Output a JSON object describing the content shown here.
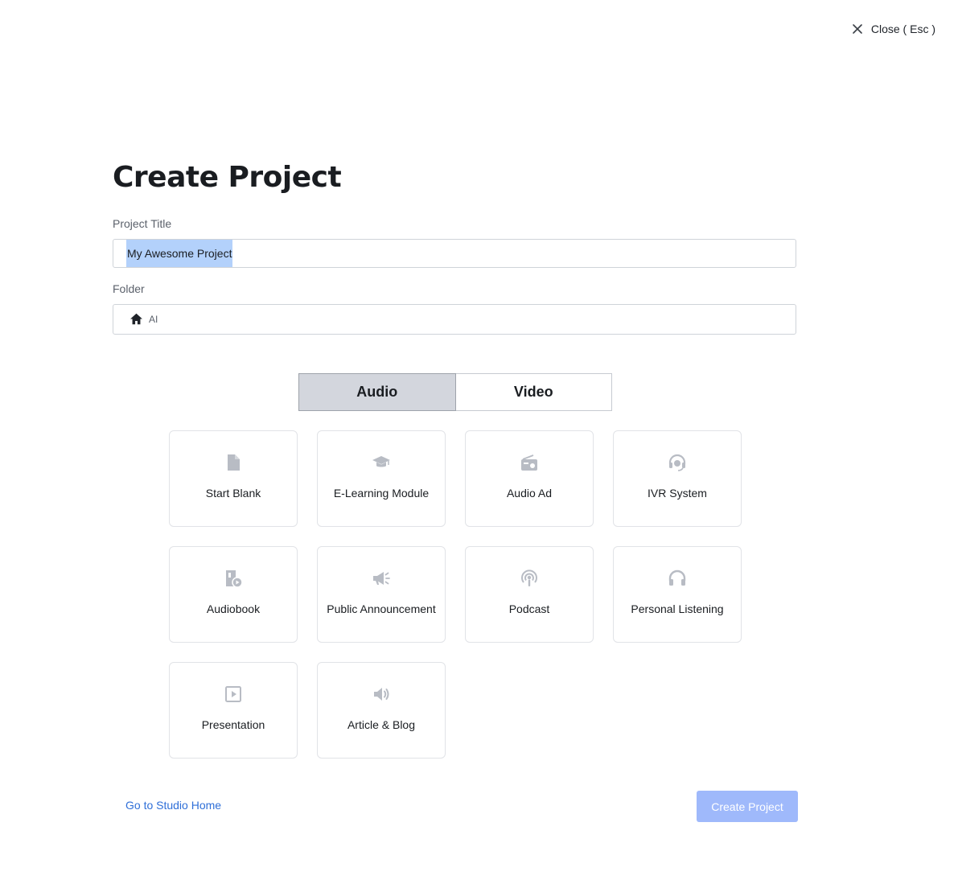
{
  "close": {
    "label": "Close ( Esc )"
  },
  "page_title": "Create Project",
  "project_title": {
    "label": "Project Title",
    "value": "My Awesome Project"
  },
  "folder": {
    "label": "Folder",
    "value": "AI"
  },
  "tabs": [
    {
      "label": "Audio",
      "active": true
    },
    {
      "label": "Video",
      "active": false
    }
  ],
  "templates": [
    {
      "label": "Start Blank",
      "icon": "file-icon"
    },
    {
      "label": "E-Learning Module",
      "icon": "graduation-cap-icon"
    },
    {
      "label": "Audio Ad",
      "icon": "radio-icon"
    },
    {
      "label": "IVR System",
      "icon": "headset-icon"
    },
    {
      "label": "Audiobook",
      "icon": "audiobook-icon"
    },
    {
      "label": "Public Announcement",
      "icon": "megaphone-icon"
    },
    {
      "label": "Podcast",
      "icon": "podcast-icon"
    },
    {
      "label": "Personal Listening",
      "icon": "headphones-icon"
    },
    {
      "label": "Presentation",
      "icon": "presentation-icon"
    },
    {
      "label": "Article & Blog",
      "icon": "speaker-icon"
    }
  ],
  "footer": {
    "home_link": "Go to Studio Home",
    "create_button": "Create Project"
  },
  "colors": {
    "accent": "#2f6fd8",
    "button_disabled": "#9fb9fb",
    "icon": "#b8bcc4",
    "selection": "#b3d1fb"
  }
}
